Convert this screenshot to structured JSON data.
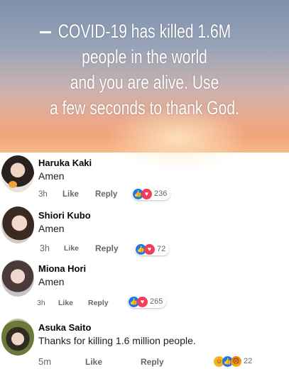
{
  "banner": {
    "lines": [
      "COVID-19 has killed 1.6M",
      "people in the world",
      "and you are alive. Use",
      "a few seconds to thank God."
    ]
  },
  "comments": [
    {
      "name": "Haruka Kaki",
      "text": "Amen",
      "time": "3h",
      "like": "Like",
      "reply": "Reply",
      "reactions": "236"
    },
    {
      "name": "Shiori Kubo",
      "text": "Amen",
      "time": "3h",
      "like": "Like",
      "reply": "Reply",
      "reactions": "72"
    },
    {
      "name": "Miona Hori",
      "text": "Amen",
      "time": "3h",
      "like": "Like",
      "reply": "Reply",
      "reactions": "265"
    },
    {
      "name": "Asuka Saito",
      "text": "Thanks for killing 1.6 million people.",
      "time": "5m",
      "like": "Like",
      "reply": "Reply",
      "reactions": "22"
    }
  ],
  "icons": {
    "like": "thumbs-up-icon",
    "love": "heart-icon",
    "haha": "laughing-face-icon",
    "angry": "angry-face-icon"
  },
  "colors": {
    "like": "#1877f2",
    "love": "#f33e58",
    "text_secondary": "#65676b"
  }
}
